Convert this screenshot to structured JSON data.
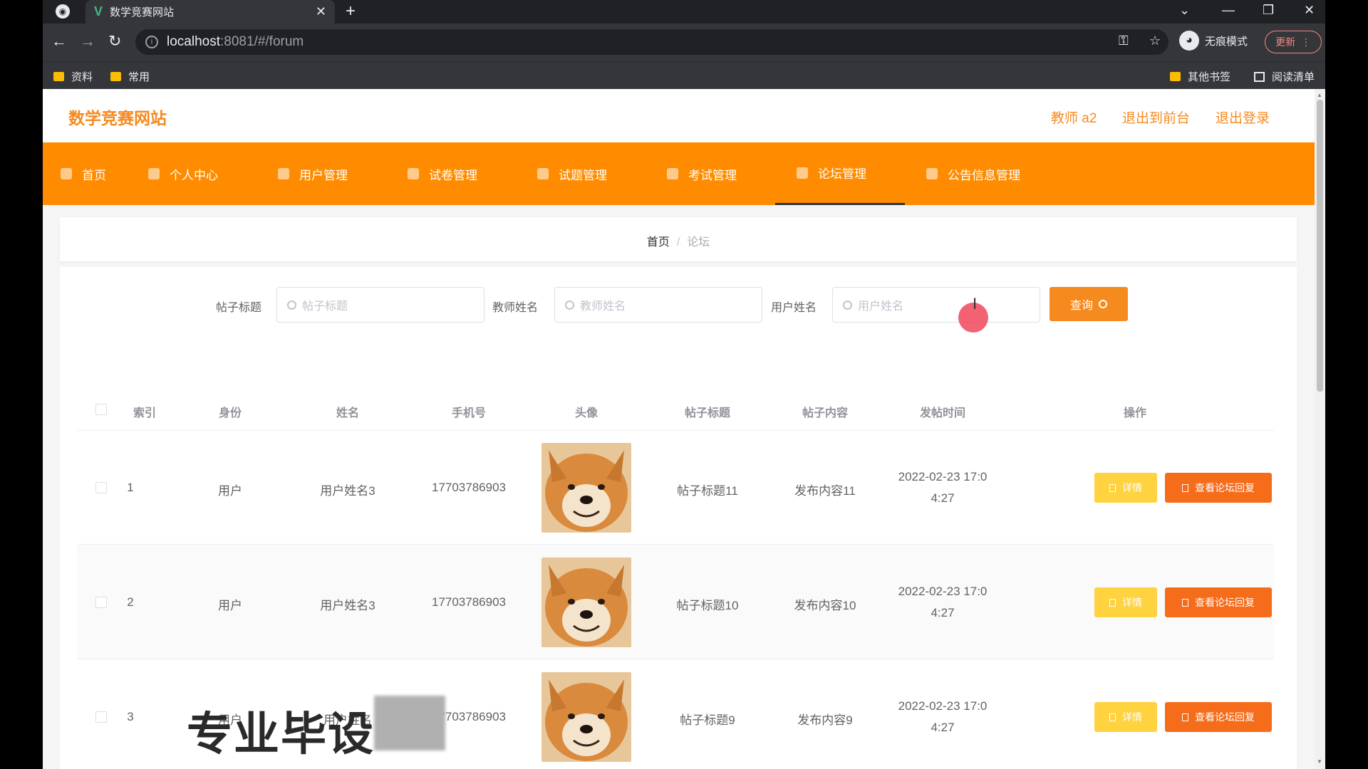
{
  "browser": {
    "tab_title": "数学竞赛网站",
    "url_host": "localhost",
    "url_path": ":8081/#/forum",
    "incognito_label": "无痕模式",
    "update_label": "更新",
    "bookmarks": [
      "资料",
      "常用"
    ],
    "bookmarks_right": [
      "其他书签",
      "阅读清单"
    ]
  },
  "header": {
    "site_title": "数学竞赛网站",
    "user_label": "教师 a2",
    "to_front_label": "退出到前台",
    "logout_label": "退出登录"
  },
  "nav": {
    "items": [
      {
        "label": "首页"
      },
      {
        "label": "个人中心"
      },
      {
        "label": "用户管理"
      },
      {
        "label": "试卷管理"
      },
      {
        "label": "试题管理"
      },
      {
        "label": "考试管理"
      },
      {
        "label": "论坛管理"
      },
      {
        "label": "公告信息管理"
      }
    ],
    "active_index": 6
  },
  "breadcrumb": {
    "home": "首页",
    "separator": "/",
    "current": "论坛"
  },
  "search": {
    "title_label": "帖子标题",
    "title_placeholder": "帖子标题",
    "teacher_label": "教师姓名",
    "teacher_placeholder": "教师姓名",
    "user_label": "用户姓名",
    "user_placeholder": "用户姓名",
    "query_label": "查询"
  },
  "table": {
    "columns": [
      "索引",
      "身份",
      "姓名",
      "手机号",
      "头像",
      "帖子标题",
      "帖子内容",
      "发帖时间",
      "操作"
    ],
    "detail_label": "详情",
    "reply_label": "查看论坛回复",
    "rows": [
      {
        "index": "1",
        "role": "用户",
        "name": "用户姓名3",
        "phone": "17703786903",
        "title": "帖子标题11",
        "content": "发布内容11",
        "time_1": "2022-02-23 17:0",
        "time_2": "4:27"
      },
      {
        "index": "2",
        "role": "用户",
        "name": "用户姓名3",
        "phone": "17703786903",
        "title": "帖子标题10",
        "content": "发布内容10",
        "time_1": "2022-02-23 17:0",
        "time_2": "4:27"
      },
      {
        "index": "3",
        "role": "用户",
        "name": "用户姓名",
        "phone": "17703786903",
        "title": "帖子标题9",
        "content": "发布内容9",
        "time_1": "2022-02-23 17:0",
        "time_2": "4:27"
      }
    ]
  },
  "watermark": "专业毕设",
  "colors": {
    "accent": "#ff8c00",
    "title_orange": "#f58a1f",
    "detail_yellow": "#ffd23f",
    "reply_orange": "#f56c1b"
  }
}
